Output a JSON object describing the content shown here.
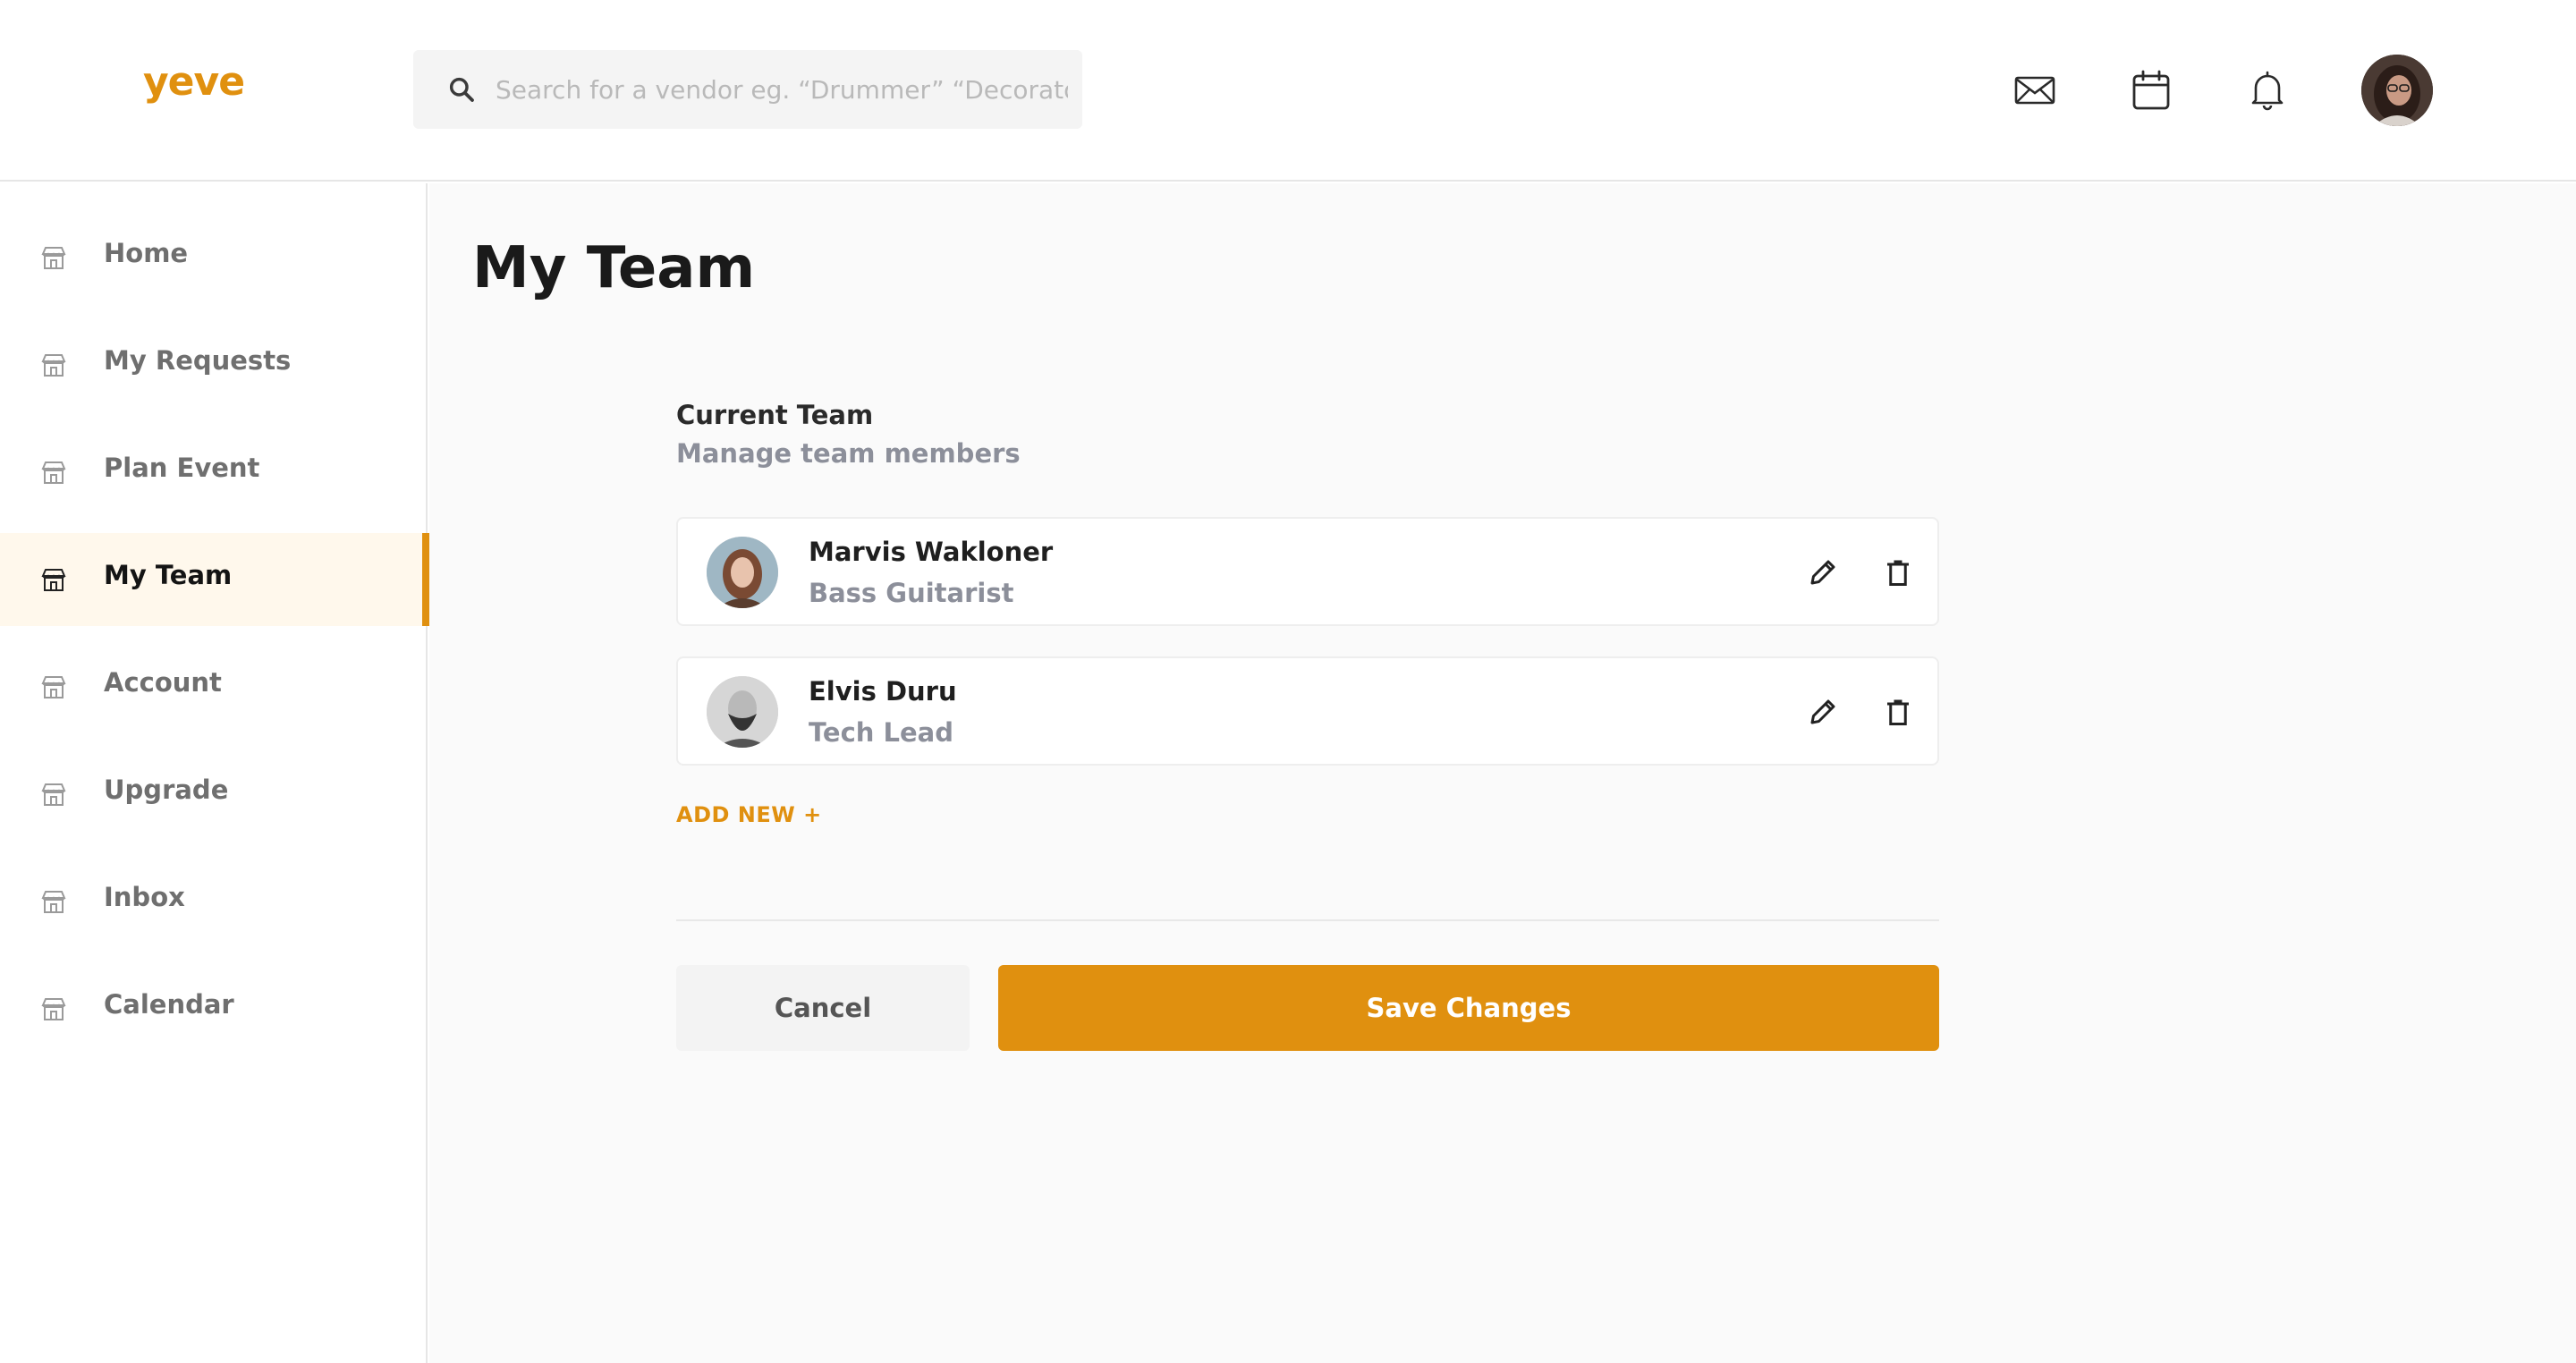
{
  "app": {
    "logo": "yeve",
    "accent_color": "#e0900f"
  },
  "search": {
    "placeholder": "Search for a vendor eg. “Drummer” “Decorator”",
    "icon": "search-icon"
  },
  "header": {
    "icons": [
      "mail-icon",
      "calendar-icon",
      "bell-icon"
    ],
    "avatar": "user-avatar"
  },
  "sidebar": {
    "items": [
      {
        "label": "Home",
        "icon": "storefront-icon",
        "active": false
      },
      {
        "label": "My Requests",
        "icon": "storefront-icon",
        "active": false
      },
      {
        "label": "Plan Event",
        "icon": "storefront-icon",
        "active": false
      },
      {
        "label": "My Team",
        "icon": "storefront-icon",
        "active": true
      },
      {
        "label": "Account",
        "icon": "storefront-icon",
        "active": false
      },
      {
        "label": "Upgrade",
        "icon": "storefront-icon",
        "active": false
      },
      {
        "label": "Inbox",
        "icon": "storefront-icon",
        "active": false
      },
      {
        "label": "Calendar",
        "icon": "storefront-icon",
        "active": false
      }
    ]
  },
  "main": {
    "title": "My Team",
    "section_title": "Current Team",
    "section_subtitle": "Manage team members",
    "members": [
      {
        "name": "Marvis Wakloner",
        "role": "Bass Guitarist"
      },
      {
        "name": "Elvis Duru",
        "role": "Tech Lead"
      }
    ],
    "add_new_label": "ADD NEW +",
    "cancel_label": "Cancel",
    "save_label": "Save Changes"
  }
}
